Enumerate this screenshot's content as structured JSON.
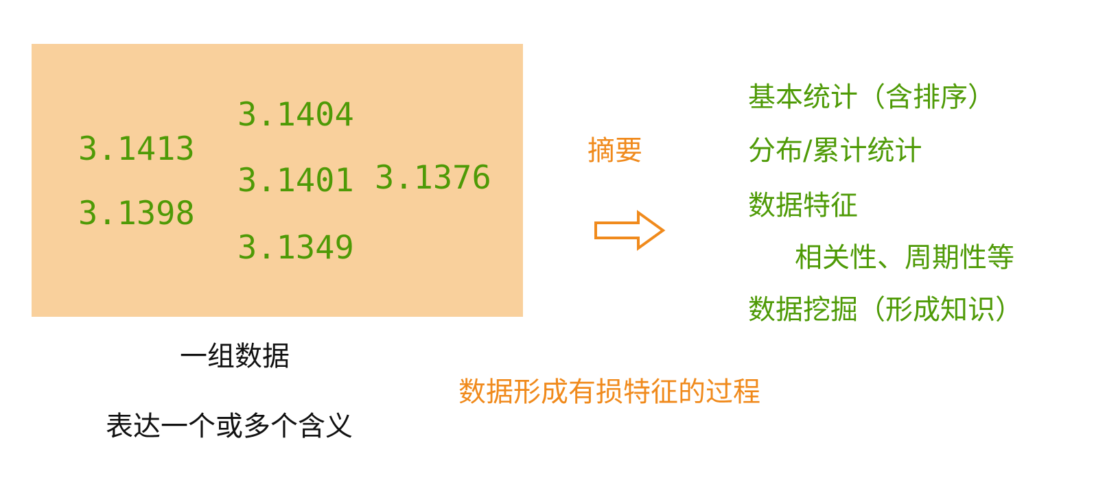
{
  "data_group": {
    "values": [
      "3.1404",
      "3.1413",
      "3.1401",
      "3.1376",
      "3.1398",
      "3.1349"
    ]
  },
  "captions": {
    "group_label": "一组数据",
    "meaning_label": "表达一个或多个含义"
  },
  "summary": {
    "label": "摘要",
    "arrow_icon": "right-outline-arrow-icon"
  },
  "features": {
    "items": [
      "基本统计（含排序）",
      "分布/累计统计",
      "数据特征",
      "相关性、周期性等",
      "数据挖掘（形成知识）"
    ]
  },
  "process_text": "数据形成有损特征的过程",
  "colors": {
    "box_background": "#f9d09c",
    "green": "#4e9a06",
    "orange": "#f08a1c",
    "black": "#111111"
  }
}
